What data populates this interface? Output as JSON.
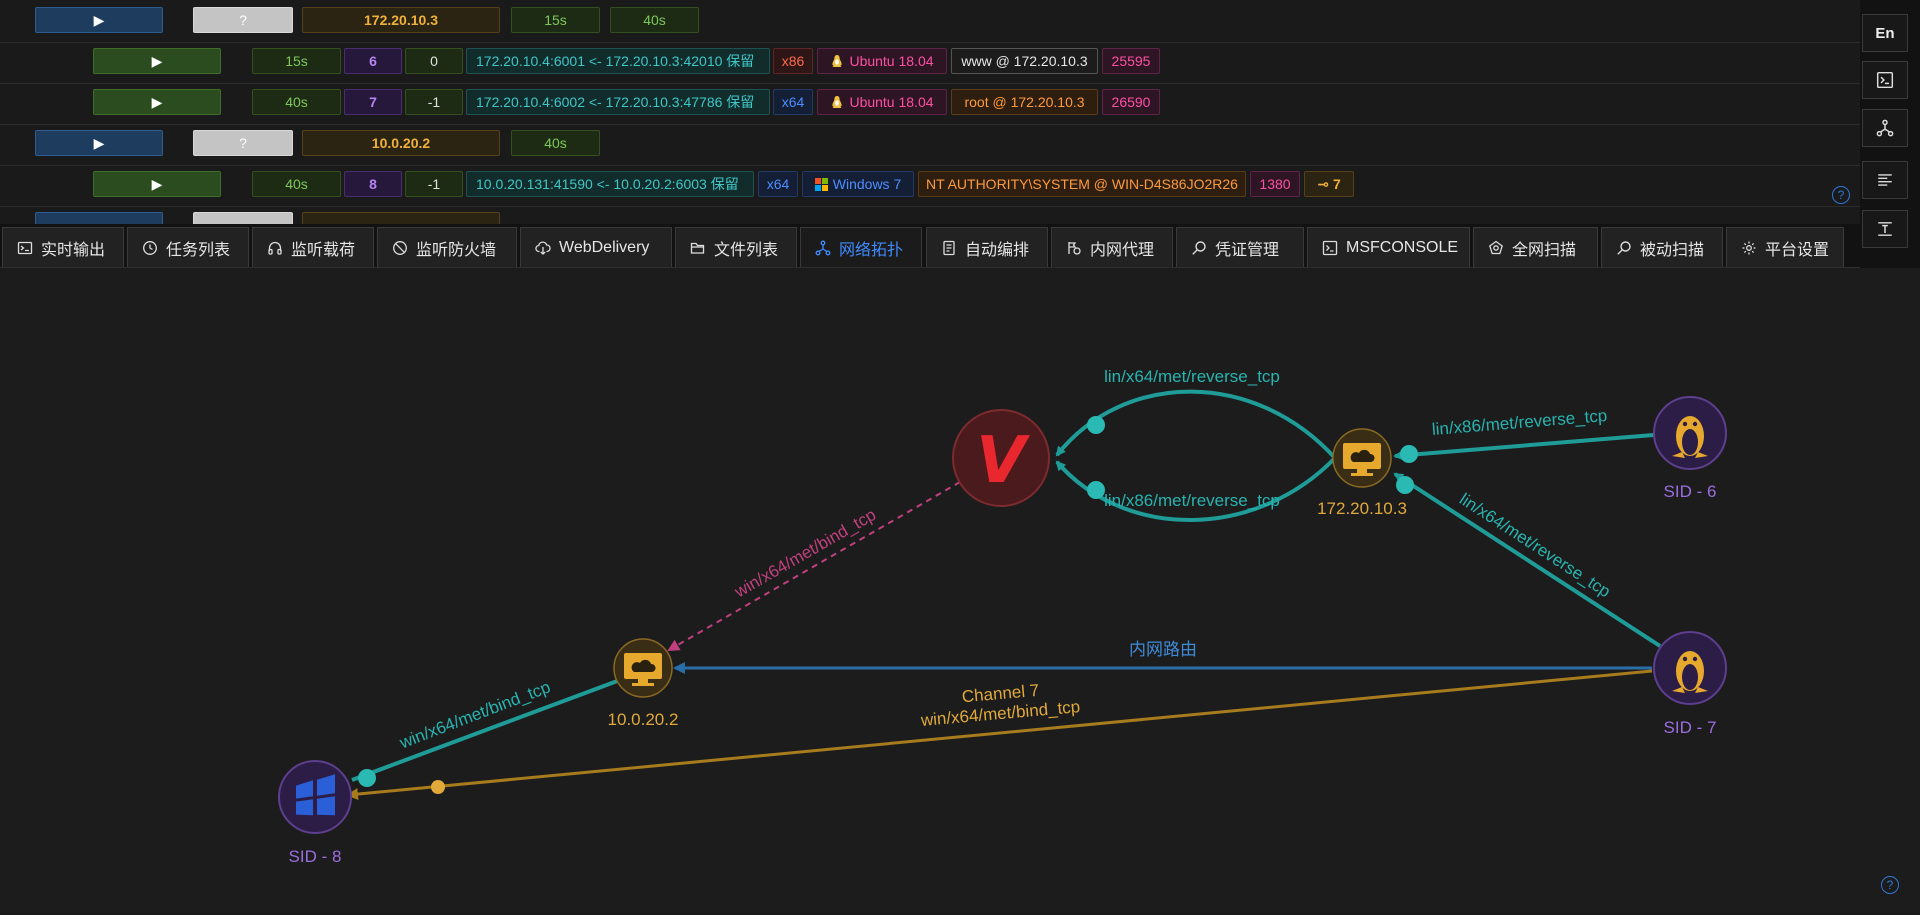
{
  "sessions": {
    "host1": {
      "ip": "172.20.10.3",
      "status": "?",
      "heartbeat": "15s",
      "interval": "40s"
    },
    "s6": {
      "heartbeat": "15s",
      "sid": "6",
      "rank": "0",
      "conn": "172.20.10.4:6001 <- 172.20.10.3:42010 保留",
      "arch": "x86",
      "os": "Ubuntu 18.04",
      "user": "www @ 172.20.10.3",
      "pid": "25595"
    },
    "s7": {
      "heartbeat": "40s",
      "sid": "7",
      "rank": "-1",
      "conn": "172.20.10.4:6002 <- 172.20.10.3:47786 保留",
      "arch": "x64",
      "os": "Ubuntu 18.04",
      "user": "root @ 172.20.10.3",
      "pid": "26590"
    },
    "host2": {
      "ip": "10.0.20.2",
      "status": "?",
      "heartbeat": "40s"
    },
    "s8": {
      "heartbeat": "40s",
      "sid": "8",
      "rank": "-1",
      "conn": "10.0.20.131:41590 <- 10.0.20.2:6003 保留",
      "arch": "x64",
      "os": "Windows 7",
      "user": "NT AUTHORITY\\SYSTEM @ WIN-D4S86JO2R26",
      "pid": "1380",
      "key": "7"
    }
  },
  "tabs": [
    "实时输出",
    "任务列表",
    "监听载荷",
    "监听防火墙",
    "WebDelivery",
    "文件列表",
    "网络拓扑",
    "自动编排",
    "内网代理",
    "凭证管理",
    "MSFCONSOLE",
    "全网扫描",
    "被动扫描",
    "平台设置"
  ],
  "sidebar": {
    "lang": "En"
  },
  "topology": {
    "nodes": {
      "host1": "172.20.10.3",
      "host2": "10.0.20.2",
      "sid6": "SID - 6",
      "sid7": "SID - 7",
      "sid8": "SID - 8",
      "center": "V"
    },
    "edges": {
      "h1_v_top": "lin/x64/met/reverse_tcp",
      "h1_v_bot": "lin/x86/met/reverse_tcp",
      "s6_h1": "lin/x86/met/reverse_tcp",
      "s7_h1": "lin/x64/met/reverse_tcp",
      "h2_v": "win/x64/met/bind_tcp",
      "s7_h2": "内网路由",
      "s8_h2": "win/x64/met/bind_tcp",
      "channel": "Channel 7",
      "channel_payload": "win/x64/met/bind_tcp"
    }
  },
  "colors": {
    "teal": "#1f9c98",
    "blue": "#2a6ea8",
    "gold": "#a87b1c",
    "pink": "#c0407e",
    "purple": "#9b6ee0",
    "accent": "#3e8bff"
  },
  "help": "?"
}
